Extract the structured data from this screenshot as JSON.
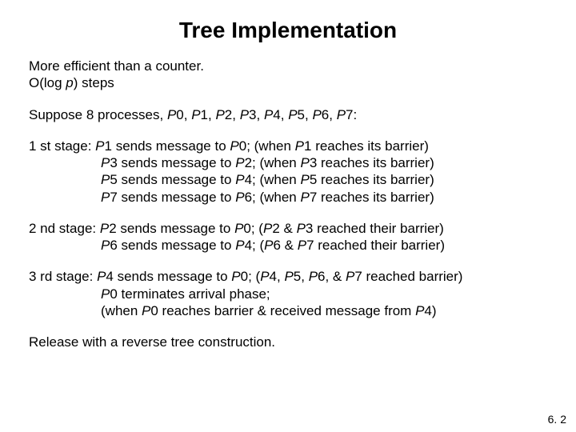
{
  "title": "Tree Implementation",
  "intro": {
    "line1": "More efficient than a counter.",
    "line2a": "O(log ",
    "line2b": "p",
    "line2c": ") steps"
  },
  "suppose": {
    "a": "Suppose 8 processes, ",
    "p0": "P",
    "n0": "0, ",
    "p1": "P",
    "n1": "1, ",
    "p2": "P",
    "n2": "2, ",
    "p3": "P",
    "n3": "3, ",
    "p4": "P",
    "n4": "4, ",
    "p5": "P",
    "n5": "5, ",
    "p6": "P",
    "n6": "6, ",
    "p7": "P",
    "n7": "7:"
  },
  "stage1": {
    "label": "1 st stage: ",
    "l1a": "P",
    "l1b": "1 sends message to ",
    "l1c": "P",
    "l1d": "0; (when ",
    "l1e": "P",
    "l1f": "1 reaches its barrier)",
    "l2a": "P",
    "l2b": "3 sends message to ",
    "l2c": "P",
    "l2d": "2; (when ",
    "l2e": "P",
    "l2f": "3 reaches its barrier)",
    "l3a": "P",
    "l3b": "5 sends message to ",
    "l3c": "P",
    "l3d": "4; (when ",
    "l3e": "P",
    "l3f": "5 reaches its barrier)",
    "l4a": "P",
    "l4b": "7 sends message to ",
    "l4c": "P",
    "l4d": "6; (when ",
    "l4e": "P",
    "l4f": "7 reaches its barrier)"
  },
  "stage2": {
    "label": "2 nd stage: ",
    "l1a": "P",
    "l1b": "2 sends message to ",
    "l1c": "P",
    "l1d": "0; (",
    "l1e": "P",
    "l1f": "2 & ",
    "l1g": "P",
    "l1h": "3 reached their barrier)",
    "l2a": "P",
    "l2b": "6 sends message to ",
    "l2c": "P",
    "l2d": "4; (",
    "l2e": "P",
    "l2f": "6 & ",
    "l2g": "P",
    "l2h": "7 reached their barrier)"
  },
  "stage3": {
    "label": "3 rd stage: ",
    "l1a": "P",
    "l1b": "4 sends message to ",
    "l1c": "P",
    "l1d": "0; (",
    "l1e": "P",
    "l1f": "4, ",
    "l1g": "P",
    "l1h": "5, ",
    "l1i": "P",
    "l1j": "6, & ",
    "l1k": "P",
    "l1l": "7 reached barrier)",
    "l2a": "P",
    "l2b": "0 terminates arrival phase;",
    "l3a": "(when ",
    "l3b": "P",
    "l3c": "0 reaches barrier & received message from ",
    "l3d": "P",
    "l3e": "4)"
  },
  "release": "Release with a reverse tree construction.",
  "footer": "6. 2"
}
